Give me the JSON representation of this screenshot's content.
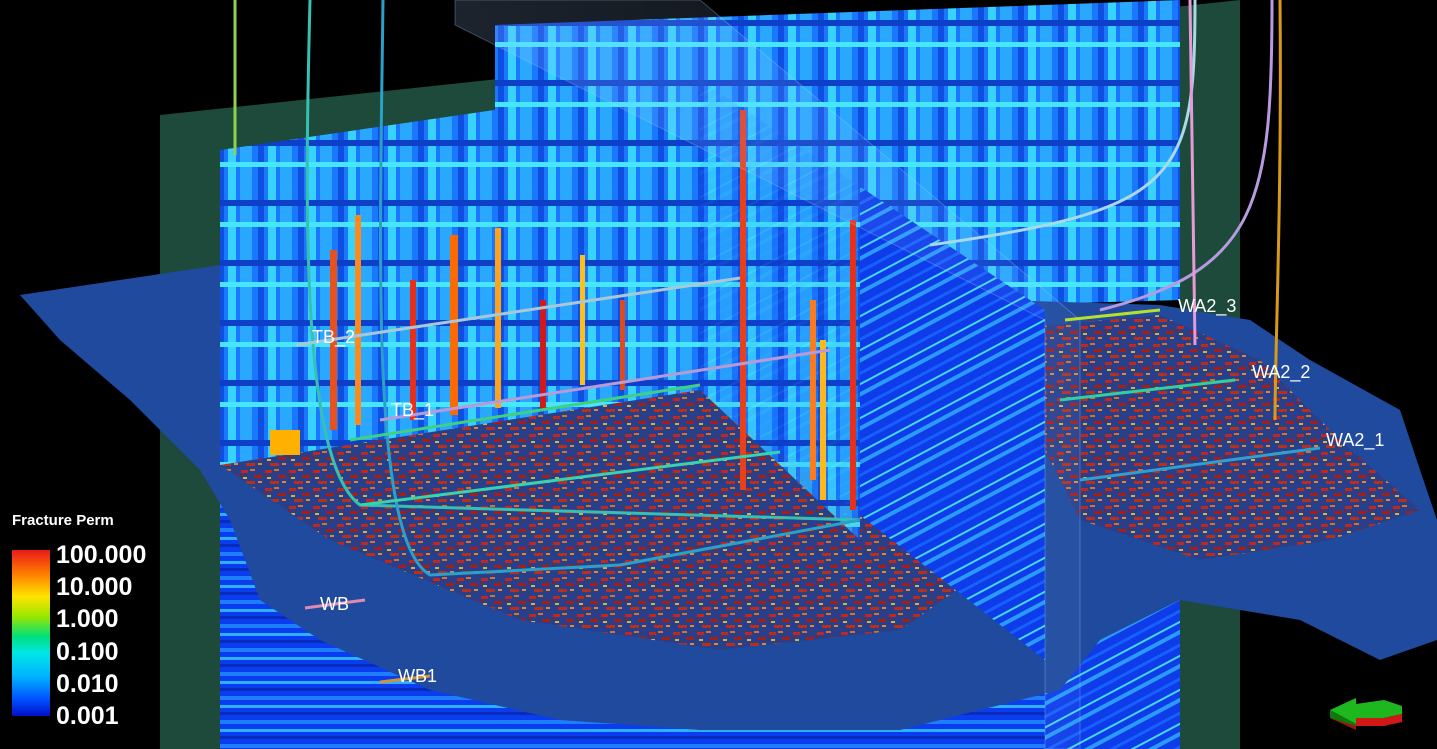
{
  "viewer": {
    "property_name": "Fracture Perm",
    "accent_colors": {
      "background": "#000000",
      "model_dark_blue": "#1f4a9e",
      "frame_green": "#1e4a3c",
      "hot": "#e81a1a",
      "cold": "#0010c8"
    }
  },
  "legend": {
    "title": "Fracture Perm",
    "ticks": [
      "100.000",
      "10.000",
      "1.000",
      "0.100",
      "0.010",
      "0.001"
    ],
    "colorscale": [
      "#e81a1a",
      "#ff7a00",
      "#ffe400",
      "#9be600",
      "#00e07a",
      "#00e6e6",
      "#00b4ff",
      "#0050ff",
      "#0010c8"
    ]
  },
  "wells": {
    "tb_2": "TB_2",
    "tb_1": "TB_1",
    "wa2_3": "WA2_3",
    "wa2_2": "WA2_2",
    "wa2_1": "WA2_1",
    "wb": "WB",
    "wb1": "WB1"
  },
  "widgets": {
    "orientation_icon": "axis-arrow-icon"
  }
}
